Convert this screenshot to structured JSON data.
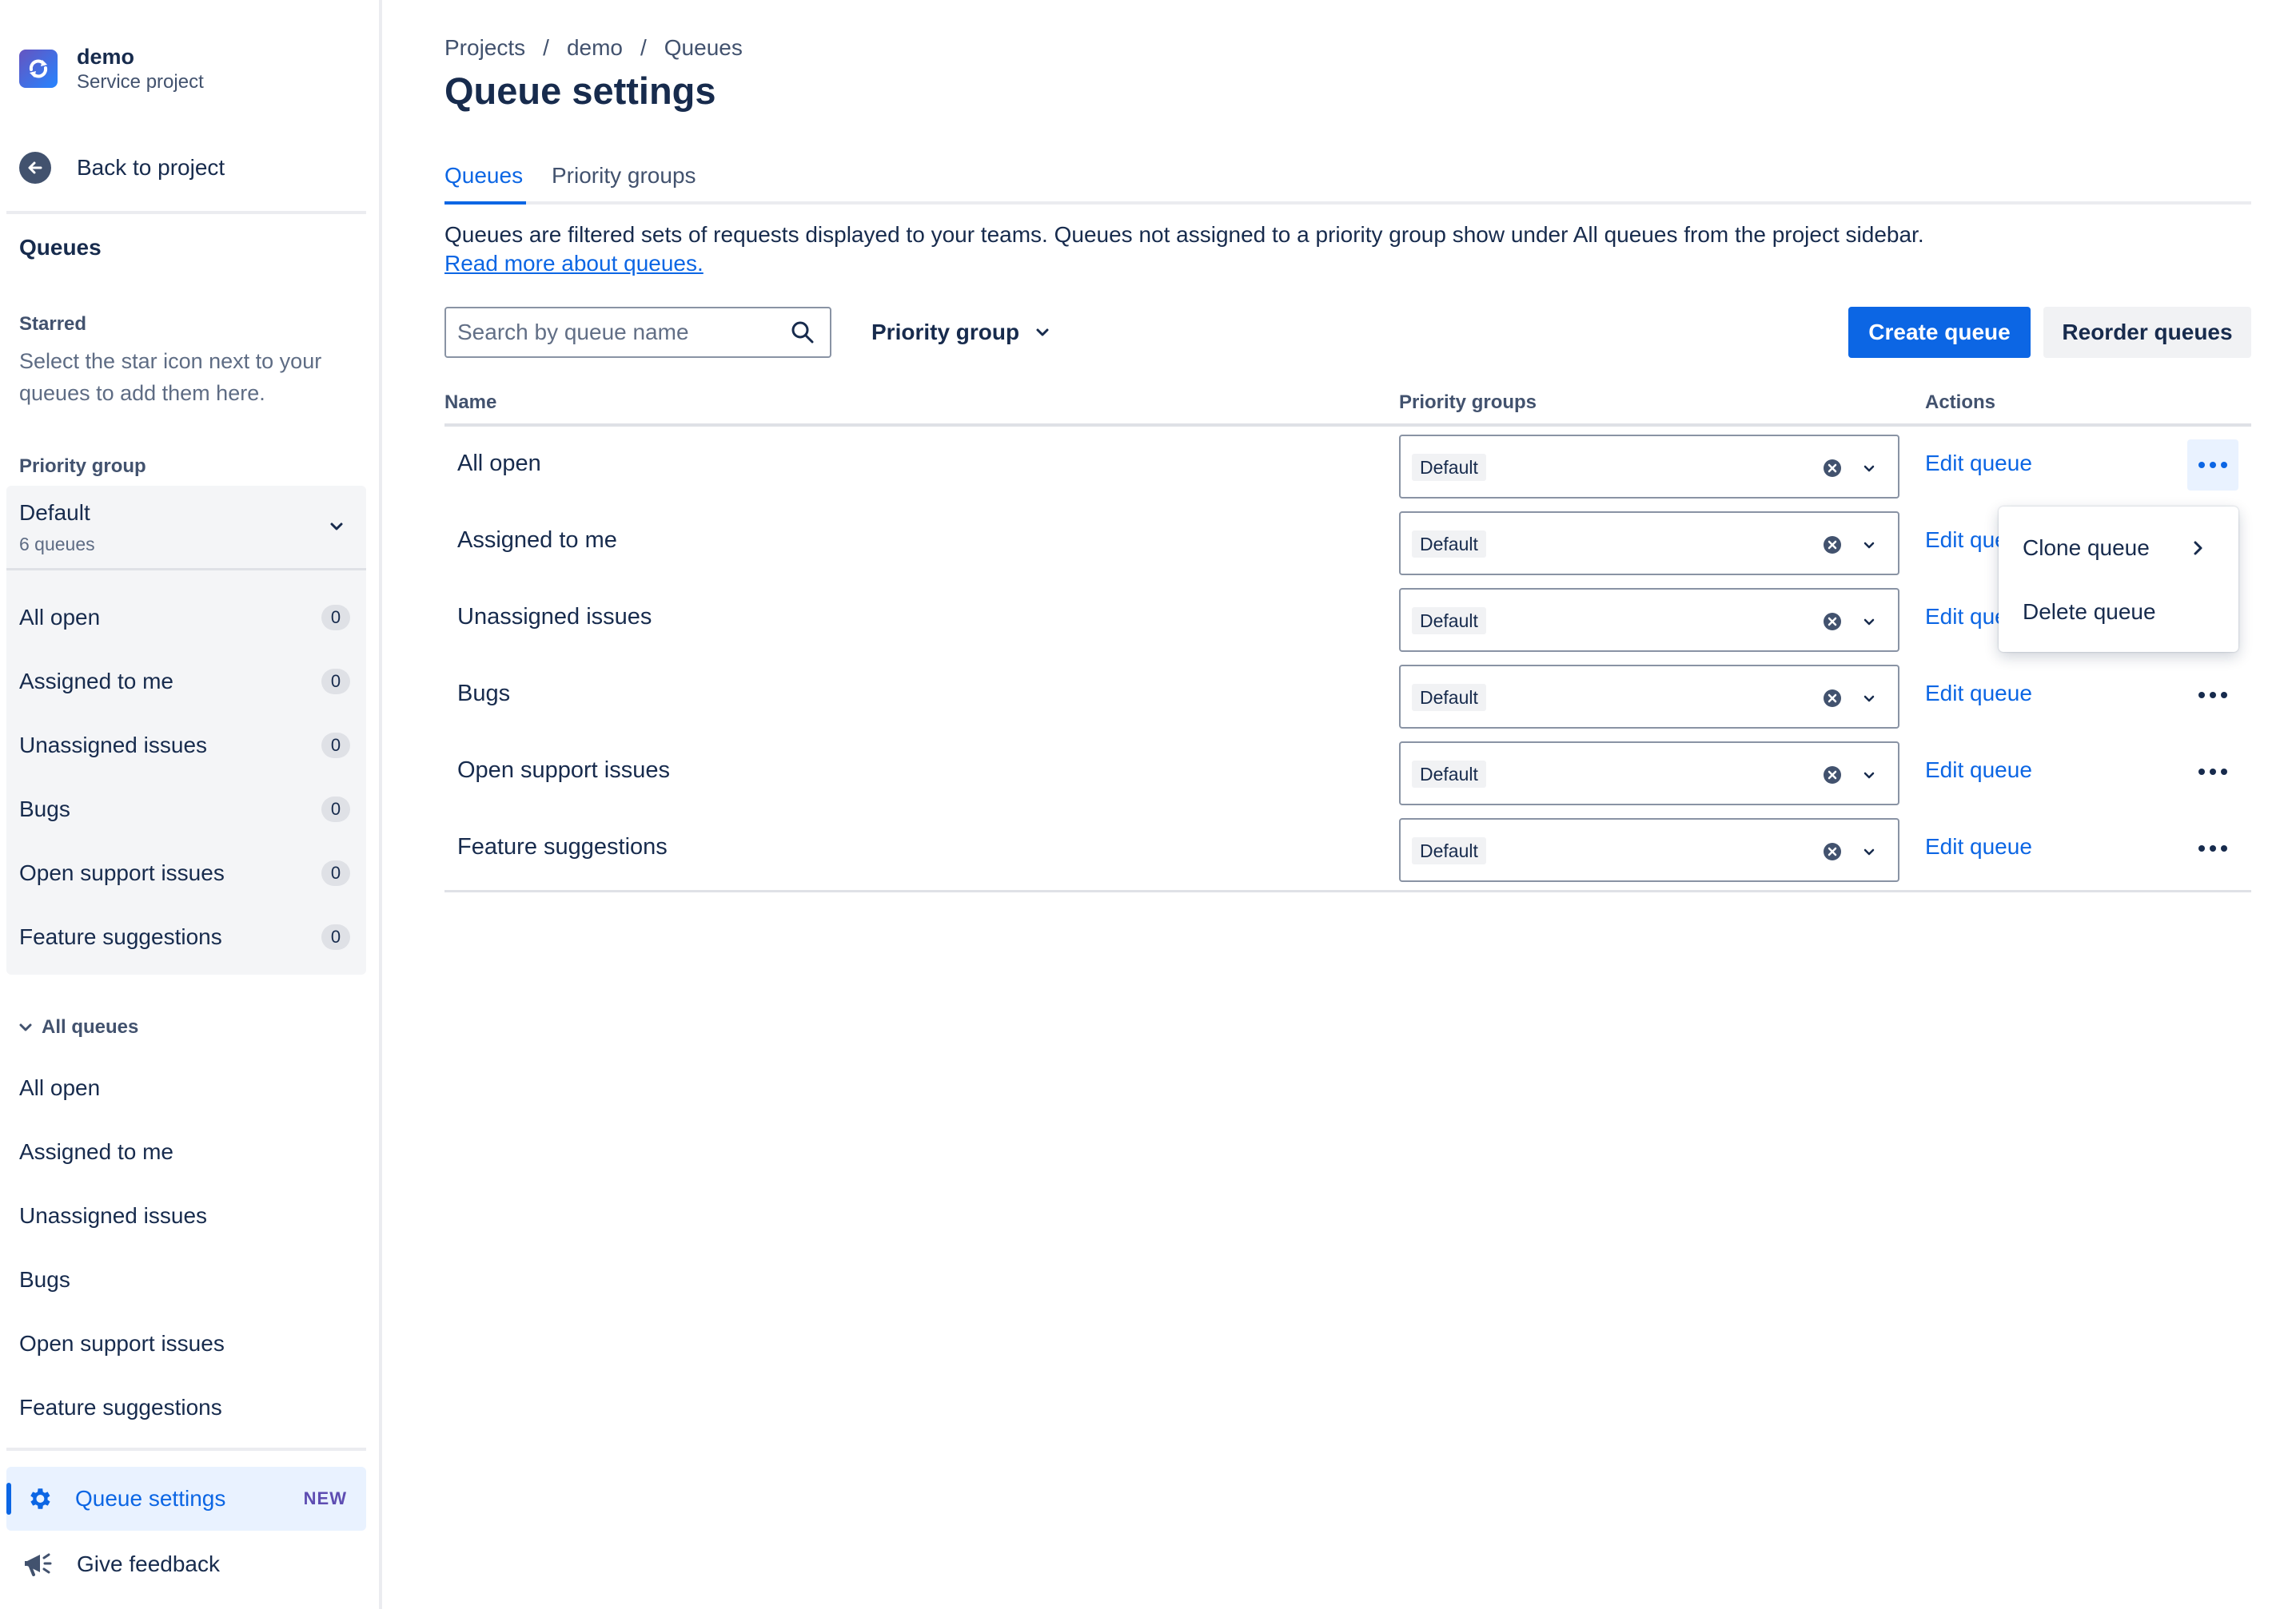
{
  "project": {
    "name": "demo",
    "type": "Service project"
  },
  "sidebar": {
    "back_label": "Back to project",
    "queues_heading": "Queues",
    "starred_heading": "Starred",
    "starred_note": "Select the star icon next to your queues to add them here.",
    "priority_group_heading": "Priority group",
    "priority_group": {
      "name": "Default",
      "count": "6 queues",
      "items": [
        {
          "label": "All open",
          "count": "0"
        },
        {
          "label": "Assigned to me",
          "count": "0"
        },
        {
          "label": "Unassigned issues",
          "count": "0"
        },
        {
          "label": "Bugs",
          "count": "0"
        },
        {
          "label": "Open support issues",
          "count": "0"
        },
        {
          "label": "Feature suggestions",
          "count": "0"
        }
      ]
    },
    "all_queues_heading": "All queues",
    "all_queues": [
      "All open",
      "Assigned to me",
      "Unassigned issues",
      "Bugs",
      "Open support issues",
      "Feature suggestions"
    ],
    "queue_settings_label": "Queue settings",
    "new_badge": "NEW",
    "feedback_label": "Give feedback"
  },
  "breadcrumbs": [
    "Projects",
    "demo",
    "Queues"
  ],
  "breadcrumb_sep": "/",
  "page_title": "Queue settings",
  "tabs": [
    {
      "label": "Queues",
      "active": true
    },
    {
      "label": "Priority groups",
      "active": false
    }
  ],
  "description": "Queues are filtered sets of requests displayed to your teams. Queues not assigned to a priority group show under All queues from the project sidebar.",
  "read_more": "Read more about queues.",
  "search": {
    "placeholder": "Search by queue name",
    "value": ""
  },
  "filter_label": "Priority group",
  "create_button": "Create queue",
  "reorder_button": "Reorder queues",
  "table": {
    "headers": {
      "name": "Name",
      "priority_groups": "Priority groups",
      "actions": "Actions"
    },
    "rows": [
      {
        "name": "All open",
        "group": "Default",
        "action": "Edit queue"
      },
      {
        "name": "Assigned to me",
        "group": "Default",
        "action": "Edit queue"
      },
      {
        "name": "Unassigned issues",
        "group": "Default",
        "action": "Edit queue"
      },
      {
        "name": "Bugs",
        "group": "Default",
        "action": "Edit queue"
      },
      {
        "name": "Open support issues",
        "group": "Default",
        "action": "Edit queue"
      },
      {
        "name": "Feature suggestions",
        "group": "Default",
        "action": "Edit queue"
      }
    ]
  },
  "row_menu": {
    "clone": "Clone queue",
    "delete": "Delete queue"
  },
  "colors": {
    "accent": "#0c66e4",
    "text": "#172b4d",
    "subtle": "#42526e",
    "new_badge": "#5e4db2"
  }
}
